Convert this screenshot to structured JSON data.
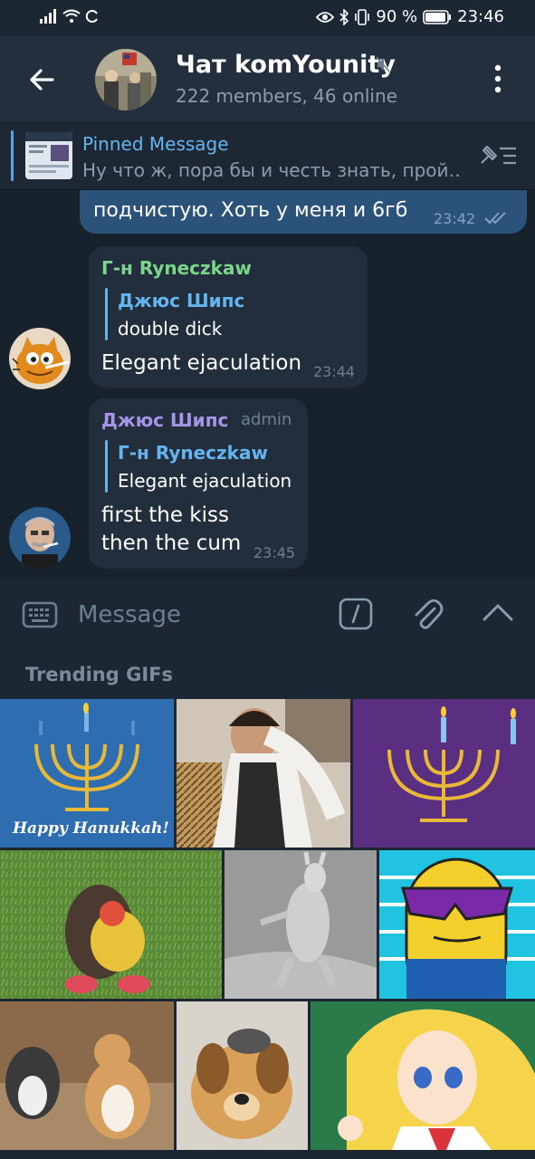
{
  "status_bar": {
    "battery_pct": "90 %",
    "time": "23:46"
  },
  "header": {
    "title": "Чат komYounity",
    "subtitle": "222 members, 46 online"
  },
  "pinned": {
    "label": "Pinned Message",
    "text": "Ну что ж, пора бы и честь знать, прой…"
  },
  "messages": {
    "outgoing": {
      "text": "подчистую. Хоть у меня и 6гб",
      "time": "23:42"
    },
    "msg1": {
      "sender": "Г-н Ryneczkaw",
      "reply_name": "Джюс Шипс",
      "reply_text": "double dick",
      "text": "Elegant ejaculation",
      "time": "23:44"
    },
    "msg2": {
      "sender": "Джюс Шипс",
      "badge": "admin",
      "reply_name": "Г-н Ryneczkaw",
      "reply_text": "Elegant ejaculation",
      "text_line1": "first the kiss",
      "text_line2": "then the cum",
      "time": "23:45"
    }
  },
  "composer": {
    "placeholder": "Message"
  },
  "gifs": {
    "title": "Trending GIFs",
    "hanukkah_text": "Happy Hanukkah!"
  },
  "colors": {
    "header_bg": "#242f3d",
    "chat_bg": "#18222d",
    "out_bubble": "#2b5278",
    "in_bubble": "#222e3c",
    "accent_blue": "#64b5ef",
    "sender_green": "#7bd58a",
    "sender_purple": "#a695e7"
  }
}
